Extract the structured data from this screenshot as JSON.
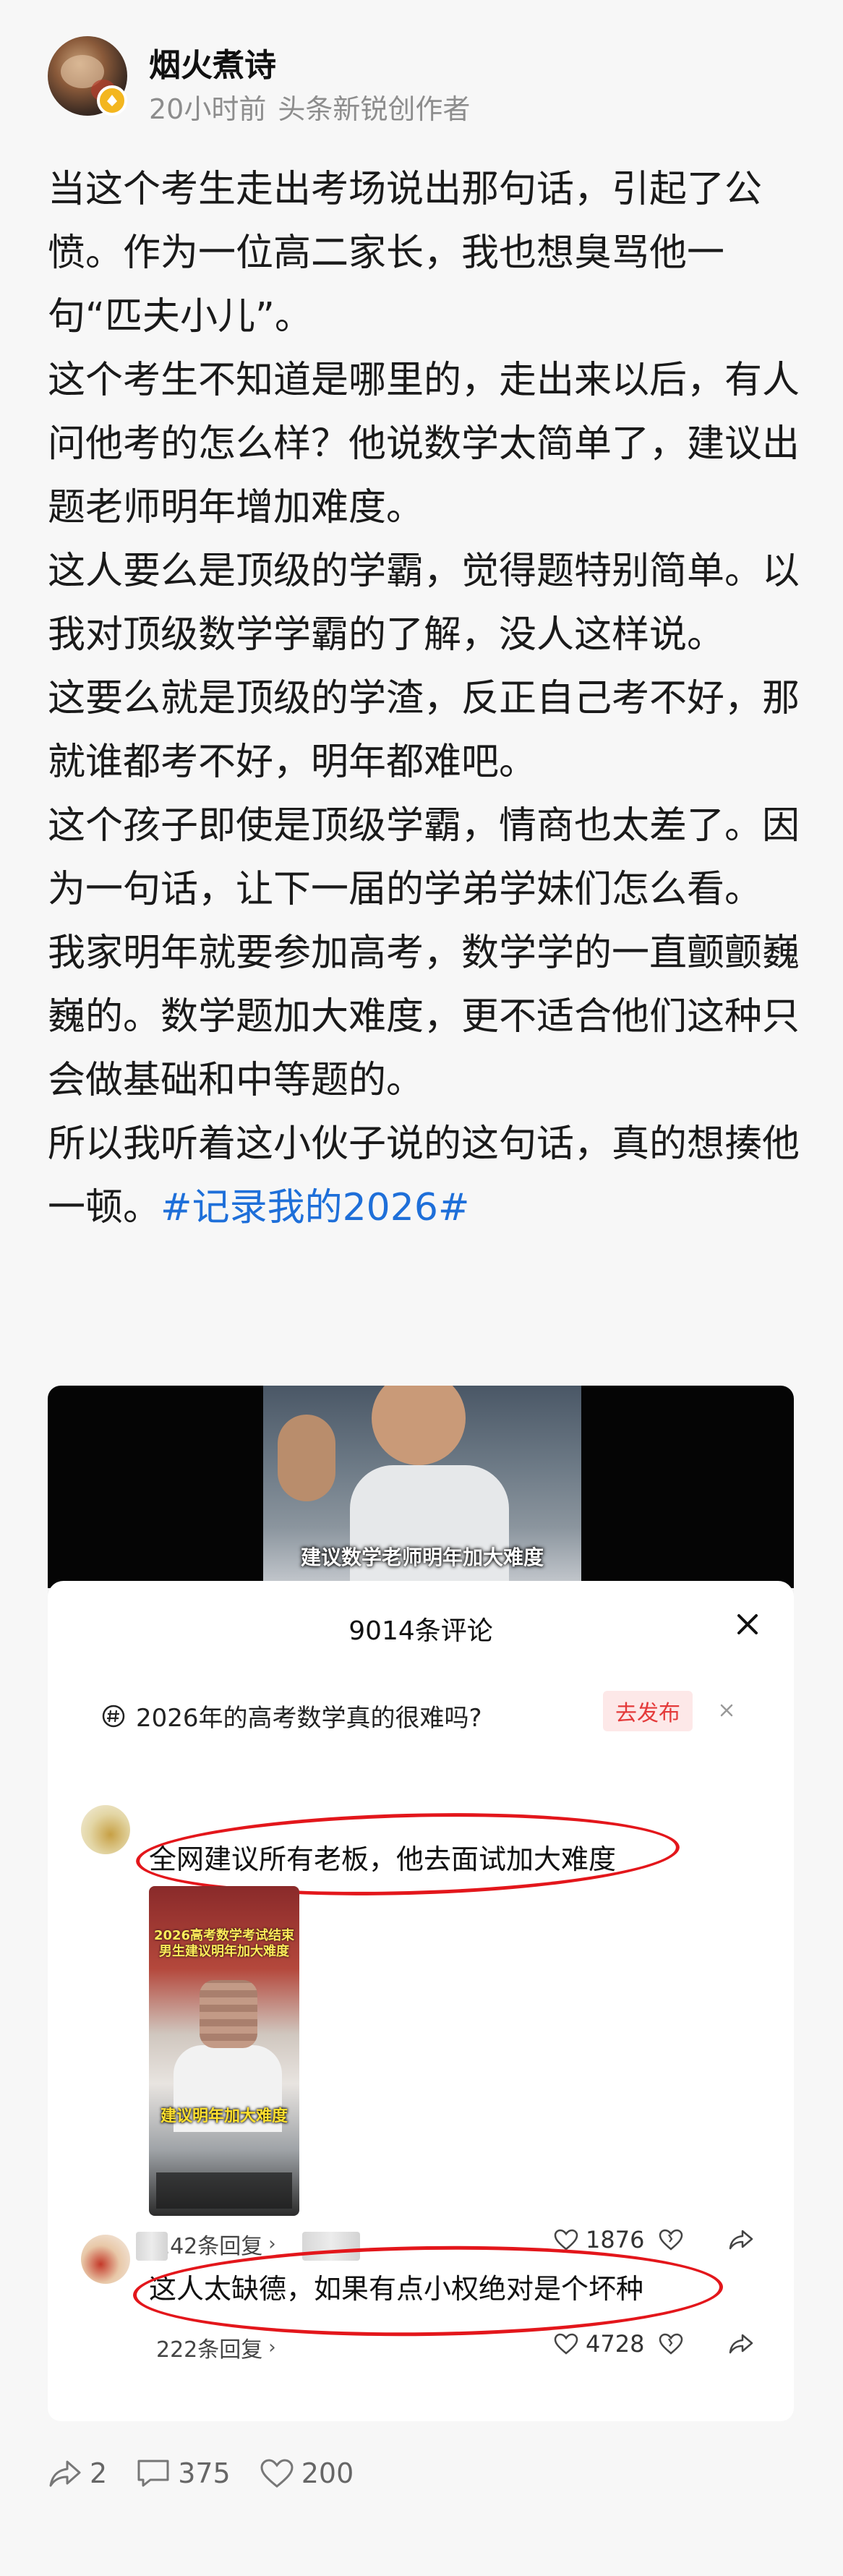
{
  "author": {
    "name": "烟火煮诗",
    "time": "20小时前",
    "tag": "头条新锐创作者",
    "avatar_icon": "profile-photo",
    "badge_icon": "creator-badge-icon"
  },
  "post": {
    "paragraphs": [
      "当这个考生走出考场说出那句话，引起了公愤。作为一位高二家长，我也想臭骂他一句“匹夫小儿”。",
      "这个考生不知道是哪里的，走出来以后，有人问他考的怎么样？他说数学太简单了，建议出题老师明年增加难度。",
      "这人要么是顶级的学霸，觉得题特别简单。以我对顶级数学学霸的了解，没人这样说。",
      "这要么就是顶级的学渣，反正自己考不好，那就谁都考不好，明年都难吧。",
      "这个孩子即使是顶级学霸，情商也太差了。因为一句话，让下一届的学弟学妹们怎么看。",
      "我家明年就要参加高考，数学学的一直颤颤巍巍的。数学题加大难度，更不适合他们这种只会做基础和中等题的。"
    ],
    "last_paragraph": "所以我听着这小伙子说的这句话，真的想揍他一顿。",
    "hashtag": "#记录我的2026#",
    "hashtag_color": "#1e6fd9"
  },
  "screenshot": {
    "video_caption": "建议数学老师明年加大难度",
    "comments_title": "9014条评论",
    "topic_text": "2026年的高考数学真的很难吗?",
    "publish_label": "去发布",
    "comments": [
      {
        "text": "全网建议所有老板，他去面试加大难度",
        "thumb_title": "2026高考数学考试结束 男生建议明年加大难度",
        "thumb_caption": "建议明年加大难度",
        "replies": "142条回复",
        "likes": "1876"
      },
      {
        "text": "这人太缺德，如果有点小权绝对是个坏种",
        "replies": "222条回复",
        "likes": "4728"
      }
    ],
    "highlight_color": "#e3161b"
  },
  "actions": {
    "shares": "2",
    "comments": "375",
    "likes": "200"
  }
}
